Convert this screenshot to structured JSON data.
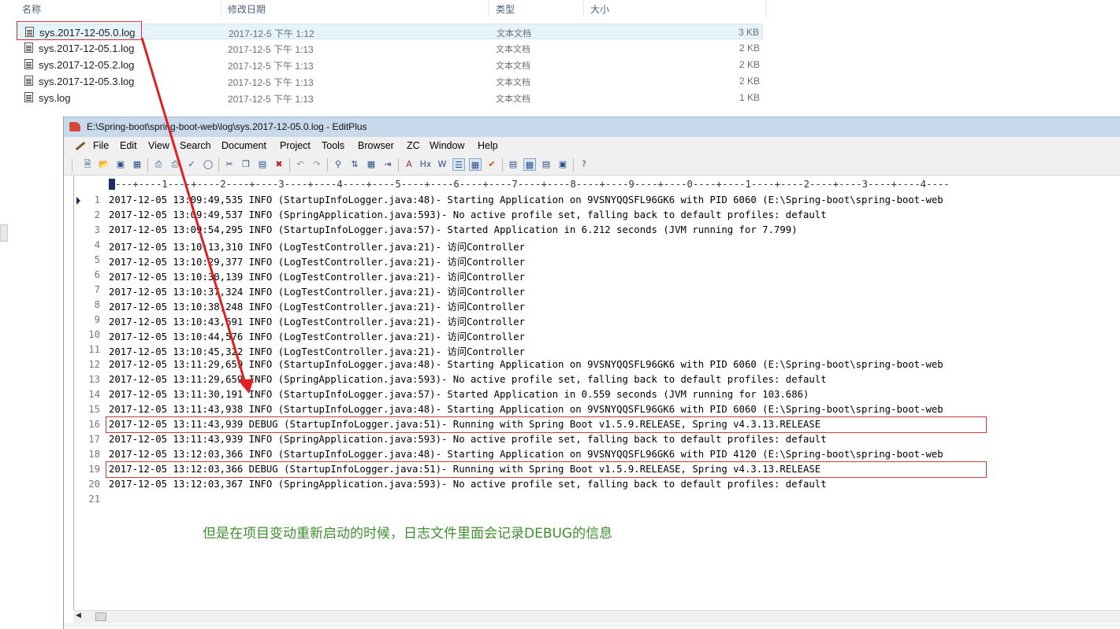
{
  "explorer": {
    "columns": {
      "name": "名称",
      "date": "修改日期",
      "type": "类型",
      "size": "大小"
    },
    "files": [
      {
        "name": "sys.2017-12-05.0.log",
        "date": "2017-12-5 下午 1:12",
        "type": "文本文档",
        "size": "3 KB"
      },
      {
        "name": "sys.2017-12-05.1.log",
        "date": "2017-12-5 下午 1:13",
        "type": "文本文档",
        "size": "2 KB"
      },
      {
        "name": "sys.2017-12-05.2.log",
        "date": "2017-12-5 下午 1:13",
        "type": "文本文档",
        "size": "2 KB"
      },
      {
        "name": "sys.2017-12-05.3.log",
        "date": "2017-12-5 下午 1:13",
        "type": "文本文档",
        "size": "2 KB"
      },
      {
        "name": "sys.log",
        "date": "2017-12-5 下午 1:13",
        "type": "文本文档",
        "size": "1 KB"
      }
    ]
  },
  "editplus": {
    "title": "E:\\Spring-boot\\spring-boot-web\\log\\sys.2017-12-05.0.log - EditPlus",
    "menu": [
      "File",
      "Edit",
      "View",
      "Search",
      "Document",
      "Project",
      "Tools",
      "Browser",
      "ZC",
      "Window",
      "Help"
    ],
    "ruler": "---+----1----+----2----+----3----+----4----+----5----+----6----+----7----+----8----+----9----+----0----+----1----+----2----+----3----+----4----",
    "line_numbers": [
      "1",
      "2",
      "3",
      "4",
      "5",
      "6",
      "7",
      "8",
      "9",
      "10",
      "11",
      "12",
      "13",
      "14",
      "15",
      "16",
      "17",
      "18",
      "19",
      "20",
      "21"
    ],
    "lines": [
      "2017-12-05 13:09:49,535 INFO (StartupInfoLogger.java:48)- Starting Application on 9VSNYQQSFL96GK6 with PID 6060 (E:\\Spring-boot\\spring-boot-web",
      "2017-12-05 13:09:49,537 INFO (SpringApplication.java:593)- No active profile set, falling back to default profiles: default",
      "2017-12-05 13:09:54,295 INFO (StartupInfoLogger.java:57)- Started Application in 6.212 seconds (JVM running for 7.799)",
      "2017-12-05 13:10:13,310 INFO (LogTestController.java:21)- 访问Controller",
      "2017-12-05 13:10:29,377 INFO (LogTestController.java:21)- 访问Controller",
      "2017-12-05 13:10:30,139 INFO (LogTestController.java:21)- 访问Controller",
      "2017-12-05 13:10:37,324 INFO (LogTestController.java:21)- 访问Controller",
      "2017-12-05 13:10:38,248 INFO (LogTestController.java:21)- 访问Controller",
      "2017-12-05 13:10:43,691 INFO (LogTestController.java:21)- 访问Controller",
      "2017-12-05 13:10:44,576 INFO (LogTestController.java:21)- 访问Controller",
      "2017-12-05 13:10:45,322 INFO (LogTestController.java:21)- 访问Controller",
      "2017-12-05 13:11:29,659 INFO (StartupInfoLogger.java:48)- Starting Application on 9VSNYQQSFL96GK6 with PID 6060 (E:\\Spring-boot\\spring-boot-web",
      "2017-12-05 13:11:29,659 INFO (SpringApplication.java:593)- No active profile set, falling back to default profiles: default",
      "2017-12-05 13:11:30,191 INFO (StartupInfoLogger.java:57)- Started Application in 0.559 seconds (JVM running for 103.686)",
      "2017-12-05 13:11:43,938 INFO (StartupInfoLogger.java:48)- Starting Application on 9VSNYQQSFL96GK6 with PID 6060 (E:\\Spring-boot\\spring-boot-web",
      "2017-12-05 13:11:43,939 DEBUG (StartupInfoLogger.java:51)- Running with Spring Boot v1.5.9.RELEASE, Spring v4.3.13.RELEASE",
      "2017-12-05 13:11:43,939 INFO (SpringApplication.java:593)- No active profile set, falling back to default profiles: default",
      "2017-12-05 13:12:03,366 INFO (StartupInfoLogger.java:48)- Starting Application on 9VSNYQQSFL96GK6 with PID 4120 (E:\\Spring-boot\\spring-boot-web",
      "2017-12-05 13:12:03,366 DEBUG (StartupInfoLogger.java:51)- Running with Spring Boot v1.5.9.RELEASE, Spring v4.3.13.RELEASE",
      "2017-12-05 13:12:03,367 INFO (SpringApplication.java:593)- No active profile set, falling back to default profiles: default",
      ""
    ]
  },
  "annotation": {
    "note": "但是在项目变动重新启动的时候，日志文件里面会记录DEBUG的信息",
    "highlight_color": "#d13a3a",
    "note_color": "#3e8f2d"
  }
}
